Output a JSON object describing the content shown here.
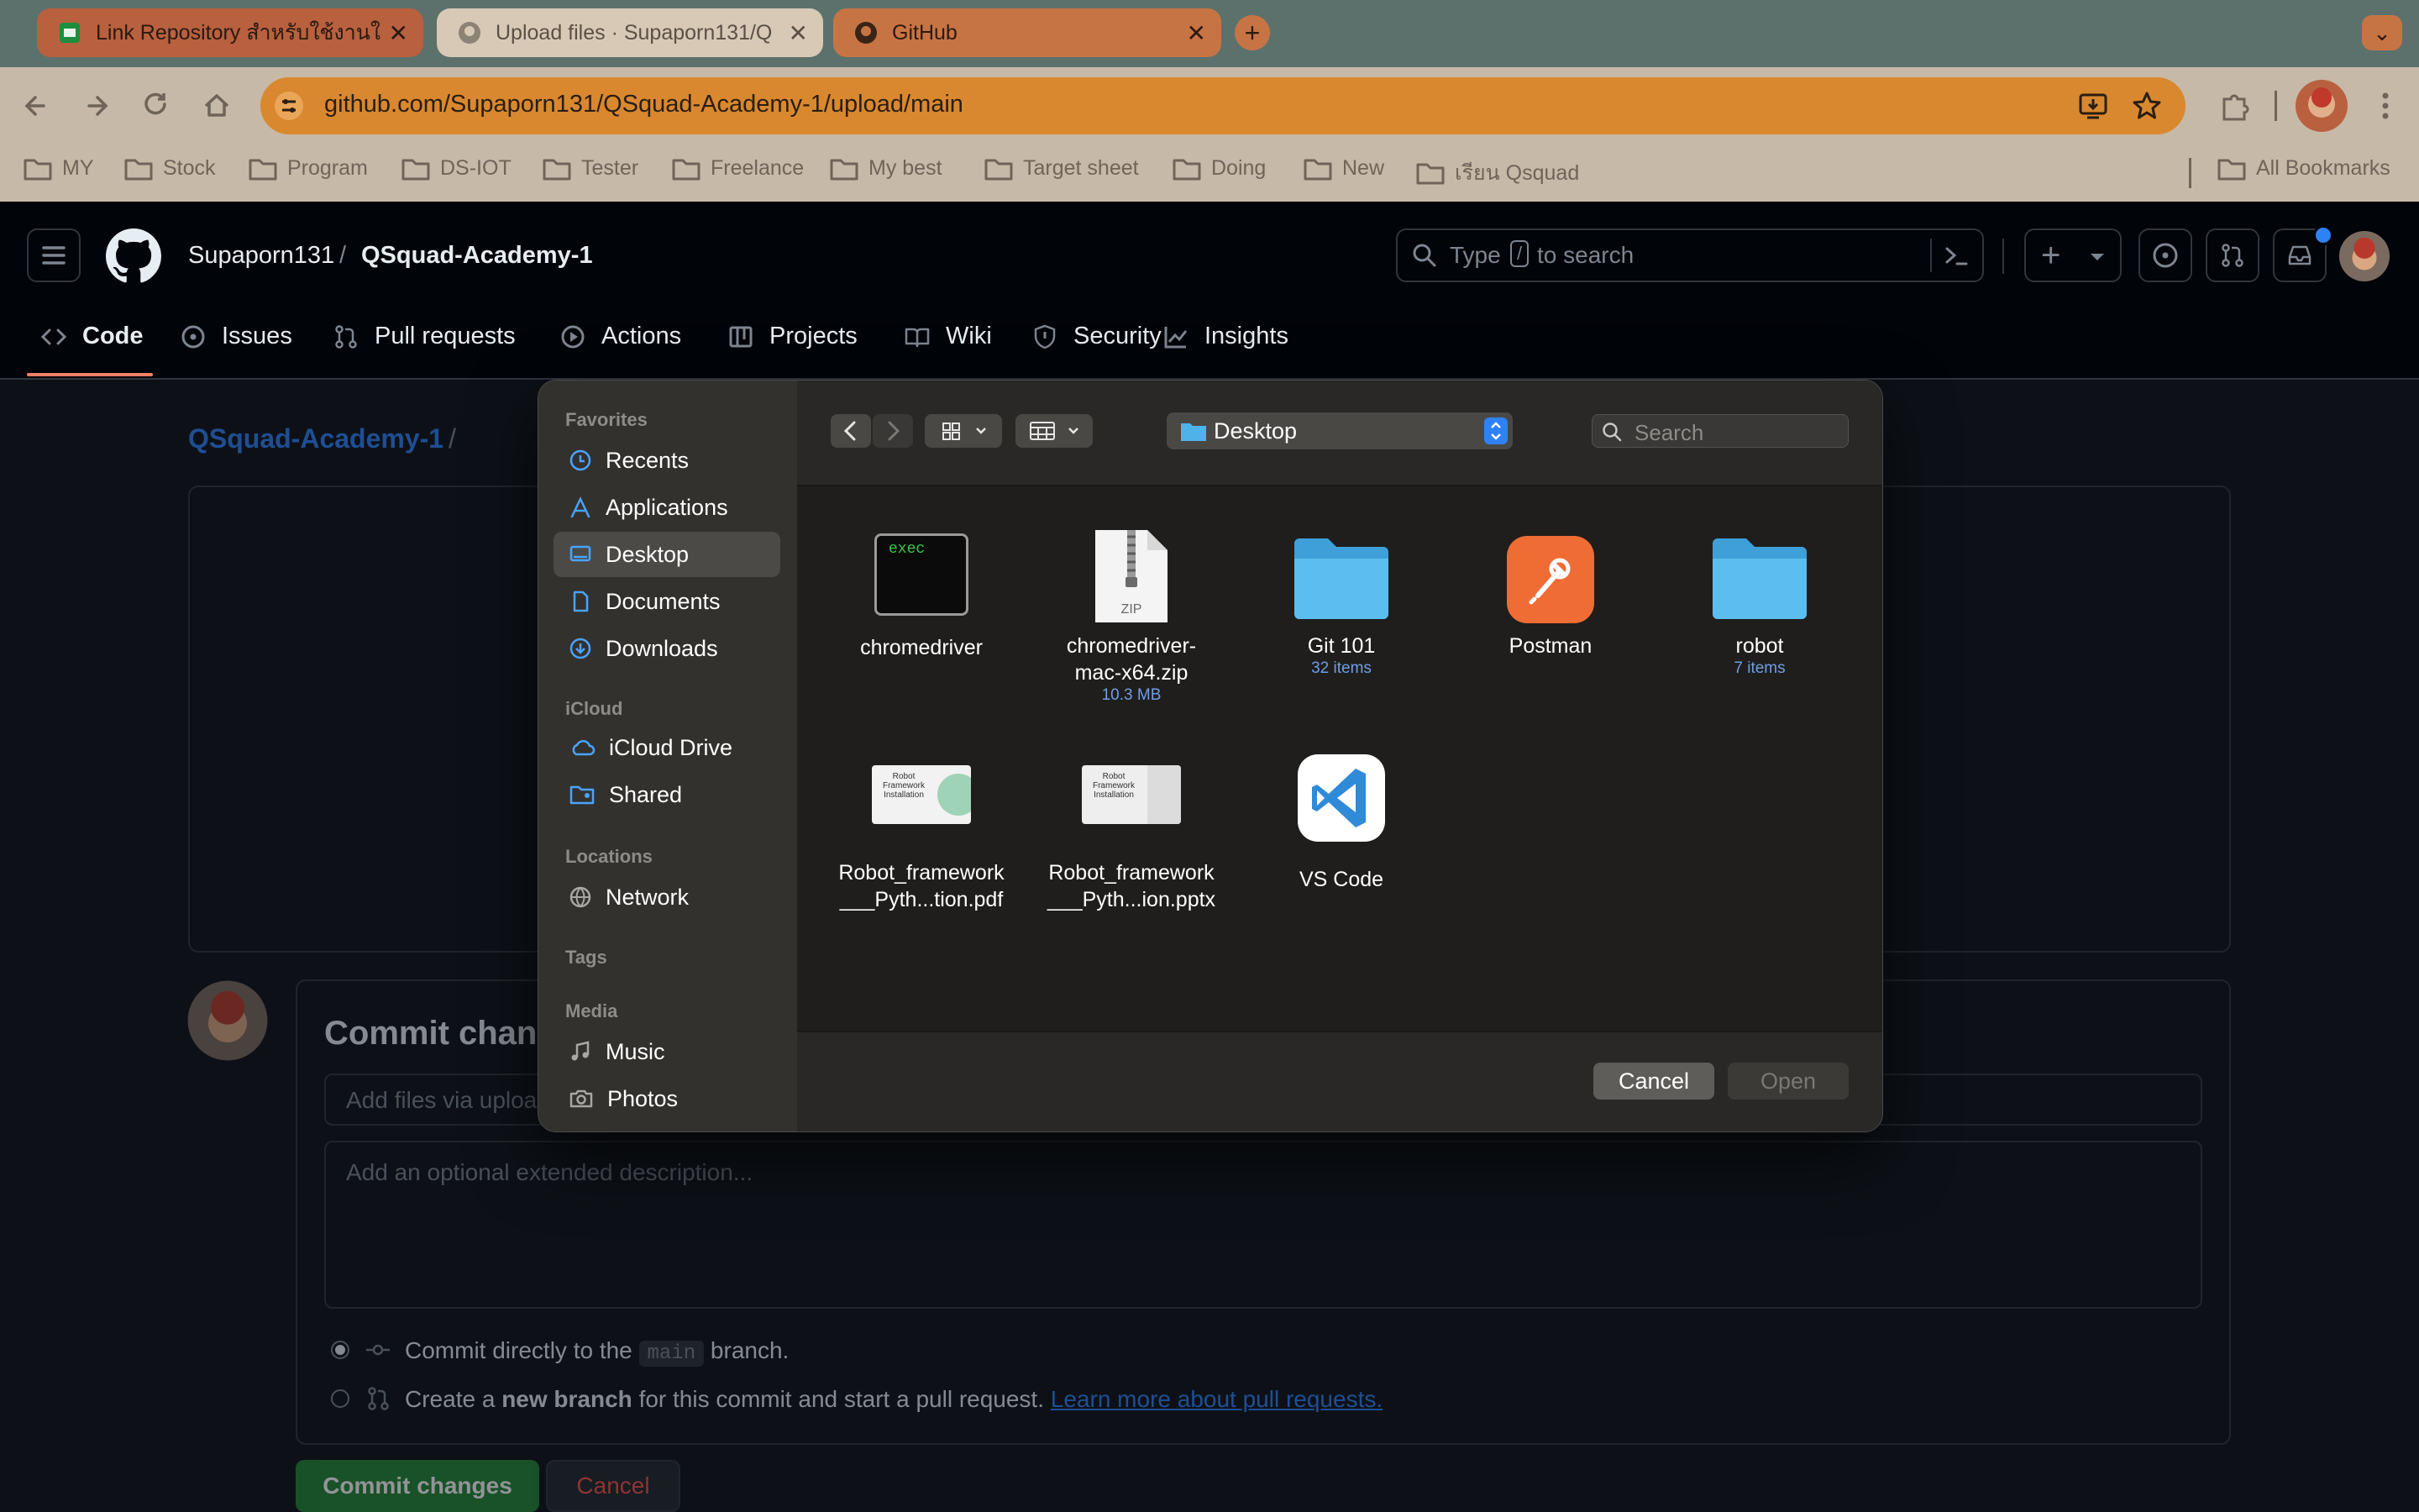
{
  "browser": {
    "tabs": [
      {
        "title": "Link Repository สำหรับใช้งานใ",
        "close": "✕"
      },
      {
        "title": "Upload files · Supaporn131/Q",
        "close": "✕"
      },
      {
        "title": "GitHub",
        "close": "✕"
      }
    ],
    "new_tab": "+",
    "tab_menu": "⌄",
    "url": "github.com/Supaporn131/QSquad-Academy-1/upload/main",
    "bookmarks": [
      "MY",
      "Stock",
      "Program",
      "DS-IOT",
      "Tester",
      "Freelance",
      "My best",
      "Target sheet",
      "Doing",
      "New",
      "เรียน Qsquad"
    ],
    "all_bookmarks": "All Bookmarks"
  },
  "github": {
    "owner": "Supaporn131",
    "separator": "/",
    "repo": "QSquad-Academy-1",
    "search_placeholder": "Type",
    "search_key": "/",
    "search_suffix": "to search",
    "plus": "+",
    "nav": [
      "Code",
      "Issues",
      "Pull requests",
      "Actions",
      "Projects",
      "Wiki",
      "Security",
      "Insights"
    ],
    "breadcrumb_repo": "QSquad-Academy-1",
    "breadcrumb_sep": "/",
    "commit_title": "Commit changes",
    "summary_placeholder": "Add files via upload",
    "description_placeholder": "Add an optional extended description...",
    "radio1_pre": "Commit directly to the",
    "radio1_branch": "main",
    "radio1_post": "branch.",
    "radio2_pre": "Create a",
    "radio2_bold": "new branch",
    "radio2_post": "for this commit and start a pull request.",
    "radio2_link": "Learn more about pull requests.",
    "commit_button": "Commit changes",
    "cancel_button": "Cancel"
  },
  "dialog": {
    "sidebar": {
      "favorites_header": "Favorites",
      "favorites": [
        "Recents",
        "Applications",
        "Desktop",
        "Documents",
        "Downloads"
      ],
      "icloud_header": "iCloud",
      "icloud": [
        "iCloud Drive",
        "Shared"
      ],
      "locations_header": "Locations",
      "locations": [
        "Network"
      ],
      "tags_header": "Tags",
      "media_header": "Media",
      "media": [
        "Music",
        "Photos"
      ]
    },
    "location": "Desktop",
    "search_placeholder": "Search",
    "files": [
      {
        "name": "chromedriver",
        "icon": "exec-icon",
        "badge": "exec"
      },
      {
        "name": "chromedriver-mac-x64.zip",
        "line1": "chromedriver-",
        "line2": "mac-x64.zip",
        "sub": "10.3 MB",
        "icon": "zip-icon",
        "badge": "ZIP"
      },
      {
        "name": "Git 101",
        "sub": "32 items",
        "icon": "folder-icon"
      },
      {
        "name": "Postman",
        "icon": "postman-icon"
      },
      {
        "name": "robot",
        "sub": "7 items",
        "icon": "folder-icon"
      },
      {
        "name": "Robot_framework___Pyth...tion.pdf",
        "line1": "Robot_framework",
        "line2": "___Pyth...tion.pdf",
        "icon": "pdf-thumbnail-icon",
        "thumb_text": "Robot Framework Installation"
      },
      {
        "name": "Robot_framework___Pyth...ion.pptx",
        "line1": "Robot_framework",
        "line2": "___Pyth...ion.pptx",
        "icon": "pptx-thumbnail-icon",
        "thumb_text": "Robot Framework Installation"
      },
      {
        "name": "VS Code",
        "icon": "vscode-icon"
      }
    ],
    "cancel_button": "Cancel",
    "open_button": "Open"
  },
  "colors": {
    "accent": "#2f81f7",
    "folder": "#4fb3ea",
    "postman": "#ef6c35",
    "commit_green": "#238636"
  }
}
